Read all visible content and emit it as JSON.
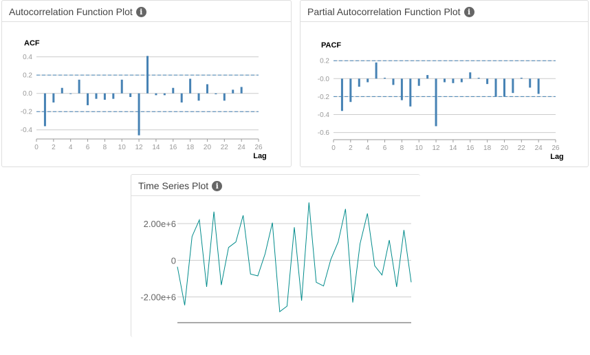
{
  "acf_panel": {
    "title": "Autocorrelation Function Plot",
    "info_icon": "info-circle-icon"
  },
  "pacf_panel": {
    "title": "Partial Autocorrelation Function Plot",
    "info_icon": "info-circle-icon"
  },
  "ts_panel": {
    "title": "Time Series Plot",
    "info_icon": "info-circle-icon"
  },
  "colors": {
    "bar": "#4682b4",
    "ts_line": "#008b8b",
    "grid": "#cccccc",
    "conf": "#4682b4"
  },
  "chart_data": [
    {
      "id": "acf",
      "type": "bar",
      "ylabel": "ACF",
      "xlabel": "Lag",
      "x_ticks": [
        0,
        2,
        4,
        6,
        8,
        10,
        12,
        14,
        16,
        18,
        20,
        22,
        24,
        26
      ],
      "y_ticks": [
        -0.4,
        -0.2,
        0.0,
        0.2,
        0.4
      ],
      "y_tick_labels": [
        "-0.4",
        "-0.2",
        "0.0",
        "0.2",
        "0.4"
      ],
      "xlim": [
        0,
        26
      ],
      "ylim": [
        -0.5,
        0.42
      ],
      "conf_band": [
        -0.2,
        0.2
      ],
      "grid": true,
      "x": [
        1,
        2,
        3,
        4,
        5,
        6,
        7,
        8,
        9,
        10,
        11,
        12,
        13,
        14,
        15,
        16,
        17,
        18,
        19,
        20,
        21,
        22,
        23,
        24
      ],
      "values": [
        -0.36,
        -0.1,
        0.06,
        0.0,
        0.15,
        -0.13,
        -0.06,
        -0.07,
        -0.06,
        0.15,
        -0.04,
        -0.46,
        0.41,
        -0.02,
        -0.02,
        0.06,
        -0.1,
        0.16,
        -0.08,
        0.1,
        -0.01,
        -0.08,
        0.04,
        0.07
      ]
    },
    {
      "id": "pacf",
      "type": "bar",
      "ylabel": "PACF",
      "xlabel": "Lag",
      "x_ticks": [
        0,
        2,
        4,
        6,
        8,
        10,
        12,
        14,
        16,
        18,
        20,
        22,
        24,
        26
      ],
      "y_ticks": [
        -0.6,
        -0.4,
        -0.2,
        0.0,
        0.2
      ],
      "y_tick_labels": [
        "-0.6",
        "-0.4",
        "-0.2",
        "-0.0",
        "0.2"
      ],
      "xlim": [
        0,
        26
      ],
      "ylim": [
        -0.68,
        0.24
      ],
      "conf_band": [
        -0.2,
        0.2
      ],
      "grid": true,
      "x": [
        1,
        2,
        3,
        4,
        5,
        6,
        7,
        8,
        9,
        10,
        11,
        12,
        13,
        14,
        15,
        16,
        17,
        18,
        19,
        20,
        21,
        22,
        23,
        24
      ],
      "values": [
        -0.36,
        -0.26,
        -0.09,
        -0.04,
        0.18,
        0.01,
        -0.07,
        -0.24,
        -0.31,
        -0.08,
        0.04,
        -0.53,
        -0.04,
        -0.05,
        -0.04,
        0.07,
        0.01,
        -0.06,
        -0.2,
        -0.2,
        -0.16,
        0.01,
        -0.1,
        -0.17
      ]
    },
    {
      "id": "ts",
      "type": "line",
      "y_ticks": [
        -2000000,
        0,
        2000000
      ],
      "y_tick_labels": [
        "-2.00e+6",
        "0",
        "2.00e+6"
      ],
      "ylim": [
        -3400000,
        3200000
      ],
      "grid": true,
      "x": [
        1,
        2,
        3,
        4,
        5,
        6,
        7,
        8,
        9,
        10,
        11,
        12,
        13,
        14,
        15,
        16,
        17,
        18,
        19,
        20,
        21,
        22,
        23,
        24,
        25,
        26,
        27,
        28,
        29,
        30,
        31,
        32,
        33,
        34,
        35,
        36,
        37,
        38,
        39,
        40,
        41
      ],
      "values": [
        -350000,
        -2450000,
        1300000,
        2200000,
        -1450000,
        2650000,
        -1350000,
        700000,
        1000000,
        2450000,
        -750000,
        -850000,
        350000,
        2050000,
        -2800000,
        -2500000,
        1800000,
        -2200000,
        3150000,
        -1200000,
        -1400000,
        50000,
        1000000,
        2800000,
        -2300000,
        900000,
        2550000,
        -300000,
        -800000,
        1100000,
        -1450000,
        1650000,
        -1200000
      ]
    }
  ]
}
